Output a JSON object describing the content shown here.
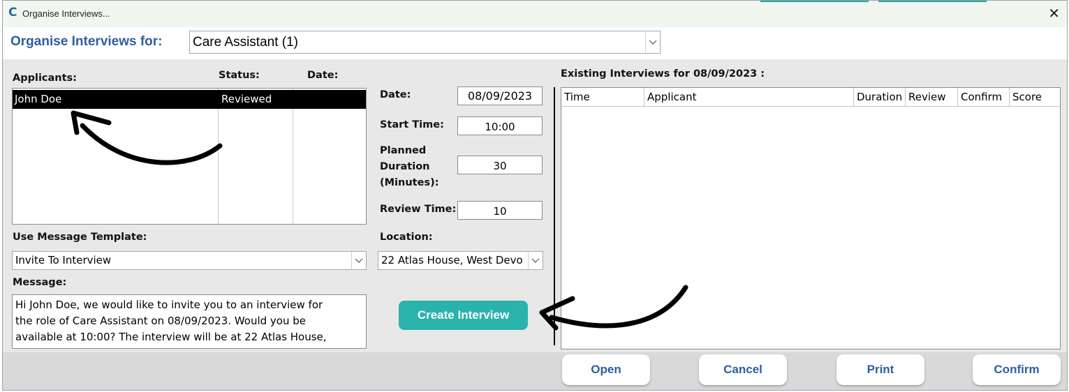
{
  "window": {
    "title": "Organise Interviews...",
    "app_icon_glyph": "C",
    "close_glyph": "✕"
  },
  "header": {
    "label": "Organise Interviews for:",
    "role_value": "Care Assistant (1)",
    "dropdown_glyph": "⌵"
  },
  "applicants": {
    "label": "Applicants:",
    "status_header": "Status:",
    "date_header": "Date:",
    "rows": [
      {
        "name": "John Doe",
        "status": "Reviewed",
        "date": "",
        "selected": true
      }
    ]
  },
  "schedule": {
    "date_label": "Date:",
    "date_value": "08/09/2023",
    "start_label": "Start Time:",
    "start_value": "10:00",
    "duration_label_1": "Planned",
    "duration_label_2": "Duration",
    "duration_label_3": "(Minutes):",
    "duration_value": "30",
    "review_label": "Review Time:",
    "review_value": "10",
    "location_label": "Location:",
    "location_value": "22 Atlas House, West Devo"
  },
  "template": {
    "label": "Use Message Template:",
    "value": "Invite To Interview"
  },
  "message": {
    "label": "Message:",
    "lines": [
      "Hi John Doe, we would like to invite you to an interview for",
      "the role of Care Assistant on 08/09/2023. Would you be",
      "available at 10:00? The interview will be at 22 Atlas House,"
    ]
  },
  "create_button": "Create Interview",
  "existing": {
    "label": "Existing Interviews for 08/09/2023 :",
    "columns": [
      "Time",
      "Applicant",
      "Duration",
      "Review",
      "Confirm",
      "Score"
    ]
  },
  "footer": {
    "open": "Open",
    "cancel": "Cancel",
    "print": "Print",
    "confirm": "Confirm"
  },
  "colors": {
    "accent_teal": "#2ab3ad",
    "label_blue": "#2e5ea0",
    "selection": "#000000"
  }
}
